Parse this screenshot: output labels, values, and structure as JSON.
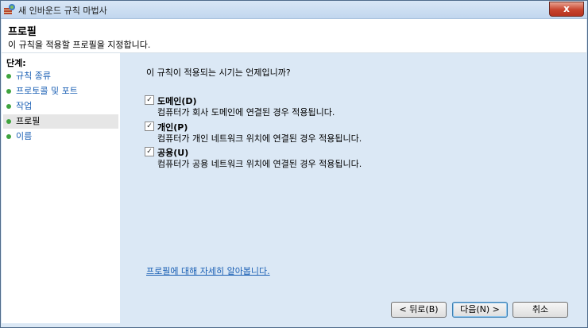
{
  "window": {
    "title": "새 인바운드 규칙 마법사",
    "close_label": "x"
  },
  "header": {
    "title": "프로필",
    "subtitle": "이 규칙을 적용할 프로필을 지정합니다."
  },
  "steps": {
    "title": "단계:",
    "items": [
      {
        "label": "규칙 종류"
      },
      {
        "label": "프로토콜 및 포트"
      },
      {
        "label": "작업"
      },
      {
        "label": "프로필"
      },
      {
        "label": "이름"
      }
    ]
  },
  "main": {
    "question": "이 규칙이 적용되는 시기는 언제입니까?",
    "options": [
      {
        "label": "도메인(D)",
        "description": "컴퓨터가 회사 도메인에 연결된 경우 적용됩니다.",
        "checked": true
      },
      {
        "label": "개인(P)",
        "description": "컴퓨터가 개인 네트워크 위치에 연결된 경우 적용됩니다.",
        "checked": true
      },
      {
        "label": "공용(U)",
        "description": "컴퓨터가 공용 네트워크 위치에 연결된 경우 적용됩니다.",
        "checked": true
      }
    ],
    "learn_more": "프로필에 대해 자세히 알아봅니다."
  },
  "buttons": {
    "back": "< 뒤로(B)",
    "next": "다음(N) >",
    "cancel": "취소"
  },
  "colors": {
    "accent": "#1a5fb4",
    "step_dot": "#3fa43f",
    "panel": "#dbe8f5"
  }
}
